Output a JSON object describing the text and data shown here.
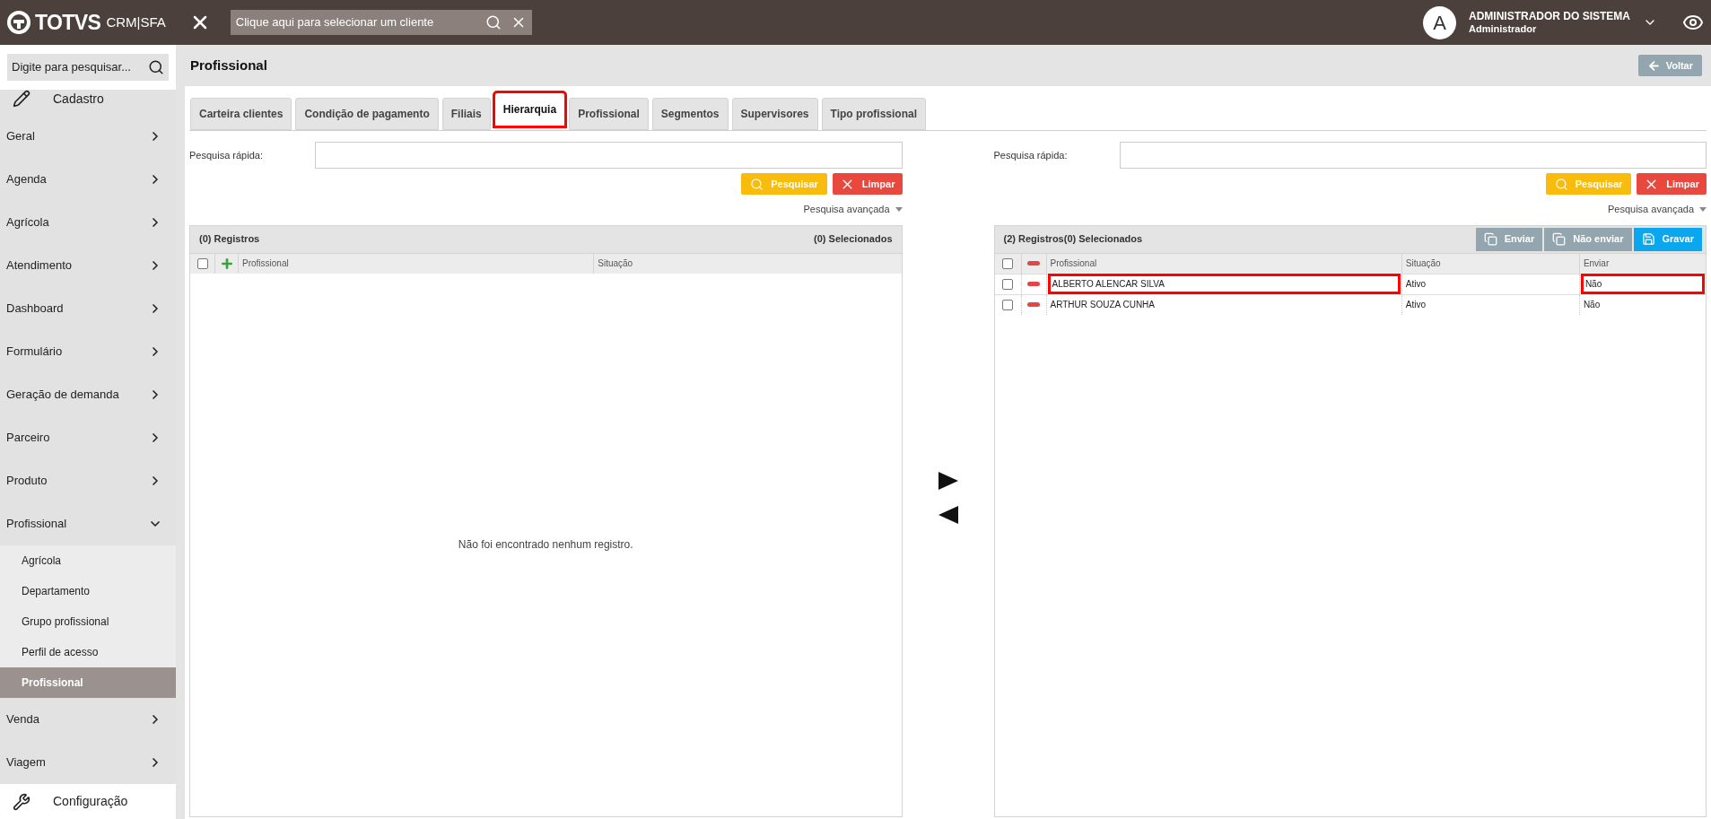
{
  "app": {
    "logo": "TOTVS",
    "product": "CRM|SFA",
    "client_search": {
      "placeholder": "Clique aqui para selecionar um cliente"
    }
  },
  "user": {
    "initial": "A",
    "name": "ADMINISTRADOR DO SISTEMA",
    "role": "Administrador"
  },
  "sidebar": {
    "search": {
      "placeholder": "Digite para pesquisar..."
    },
    "items": [
      {
        "kind": "section",
        "label": "Cadastro"
      },
      {
        "kind": "menu",
        "label": "Geral",
        "expanded": false
      },
      {
        "kind": "menu",
        "label": "Agenda",
        "expanded": false
      },
      {
        "kind": "menu",
        "label": "Agrícola",
        "expanded": false
      },
      {
        "kind": "menu",
        "label": "Atendimento",
        "expanded": false
      },
      {
        "kind": "menu",
        "label": "Dashboard",
        "expanded": false
      },
      {
        "kind": "menu",
        "label": "Formulário",
        "expanded": false
      },
      {
        "kind": "menu",
        "label": "Geração de demanda",
        "expanded": false
      },
      {
        "kind": "menu",
        "label": "Parceiro",
        "expanded": false
      },
      {
        "kind": "menu",
        "label": "Produto",
        "expanded": false
      },
      {
        "kind": "menu",
        "label": "Profissional",
        "expanded": true,
        "children": [
          {
            "label": "Agrícola",
            "selected": false
          },
          {
            "label": "Departamento",
            "selected": false
          },
          {
            "label": "Grupo profissional",
            "selected": false
          },
          {
            "label": "Perfil de acesso",
            "selected": false
          },
          {
            "label": "Profissional",
            "selected": true
          }
        ]
      },
      {
        "kind": "menu",
        "label": "Venda",
        "expanded": false
      },
      {
        "kind": "menu",
        "label": "Viagem",
        "expanded": false
      },
      {
        "kind": "section",
        "label": "Configuração"
      }
    ]
  },
  "page": {
    "title": "Profissional",
    "back_button": "Voltar"
  },
  "tabs": [
    {
      "label": "Carteira clientes",
      "selected": false,
      "highlighted": false
    },
    {
      "label": "Condição de pagamento",
      "selected": false,
      "highlighted": false
    },
    {
      "label": "Filiais",
      "selected": false,
      "highlighted": false
    },
    {
      "label": "Hierarquia",
      "selected": true,
      "highlighted": true
    },
    {
      "label": "Profissional",
      "selected": false,
      "highlighted": false
    },
    {
      "label": "Segmentos",
      "selected": false,
      "highlighted": false
    },
    {
      "label": "Supervisores",
      "selected": false,
      "highlighted": false
    },
    {
      "label": "Tipo profissional",
      "selected": false,
      "highlighted": false
    }
  ],
  "panels": [
    {
      "quick_search_label": "Pesquisa rápida:",
      "search_button": "Pesquisar",
      "clear_button": "Limpar",
      "advanced_search": "Pesquisa avançada",
      "grid": {
        "summary": "(0) Registros",
        "selected_summary": "(0) Selecionados",
        "header_icon": {
          "kind": "add"
        },
        "all_checked": false,
        "columns": [
          "Profissional",
          "Situação"
        ],
        "empty_message": "Não foi encontrado nenhum registro."
      }
    },
    {
      "quick_search_label": "Pesquisa rápida:",
      "search_button": "Pesquisar",
      "clear_button": "Limpar",
      "advanced_search": "Pesquisa avançada",
      "grid": {
        "summary": "(2) Registros(0) Selecionados",
        "actions": [
          {
            "kind": "copy",
            "label": "Enviar"
          },
          {
            "kind": "copy",
            "label": "Não enviar"
          },
          {
            "kind": "save",
            "label": "Gravar"
          }
        ],
        "header_icon": {
          "kind": "remove"
        },
        "all_checked": false,
        "columns": [
          "Profissional",
          "Situação",
          "Enviar"
        ],
        "rows": [
          {
            "checked": false,
            "cells": [
              {
                "text": "ALBERTO ALENCAR SILVA",
                "highlighted": true
              },
              {
                "text": "Ativo",
                "highlighted": false
              },
              {
                "text": "Não",
                "highlighted": true
              }
            ]
          },
          {
            "checked": false,
            "cells": [
              {
                "text": "ARTHUR SOUZA CUNHA",
                "highlighted": false
              },
              {
                "text": "Ativo",
                "highlighted": false
              },
              {
                "text": "Não",
                "highlighted": false
              }
            ]
          }
        ]
      }
    }
  ]
}
